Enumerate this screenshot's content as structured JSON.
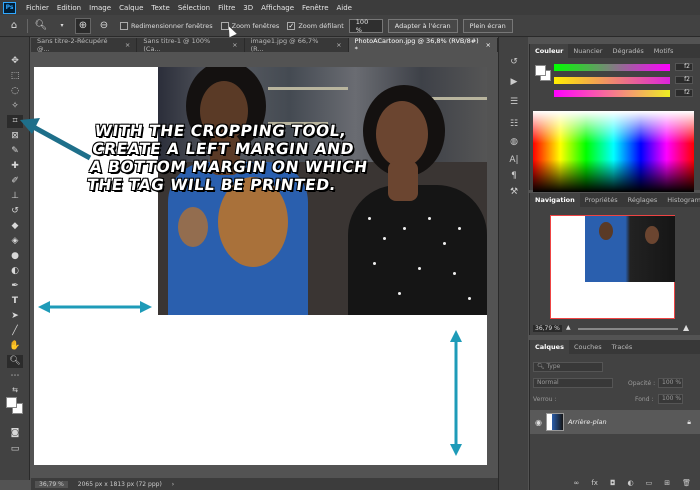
{
  "app": {
    "logo": "Ps"
  },
  "menu": [
    "Fichier",
    "Edition",
    "Image",
    "Calque",
    "Texte",
    "Sélection",
    "Filtre",
    "3D",
    "Affichage",
    "Fenêtre",
    "Aide"
  ],
  "options": {
    "resize_windows": "Redimensionner fenêtres",
    "zoom_all": "Zoom fenêtres",
    "scrubby_zoom": "Zoom défilant",
    "zoom_value": "100 %",
    "fit_screen": "Adapter à l'écran",
    "fill_screen": "Plein écran"
  },
  "tabs": [
    {
      "label": "Sans titre-2-Récupéré @...",
      "close": "×"
    },
    {
      "label": "Sans titre-1 @ 100% (Ca...",
      "close": "×"
    },
    {
      "label": "image1.jpg @ 66,7% (R...",
      "close": "×"
    },
    {
      "label": "PhotoACartoon.jpg @ 36,8% (RVB/8#) *",
      "close": "×"
    }
  ],
  "caption": "WITH THE CROPPING TOOL,\nCREATE A LEFT MARGIN AND\nA BOTTOM MARGIN ON WHICH\nTHE TAG WILL BE PRINTED.",
  "status": {
    "zoom": "36,79 %",
    "doc_size": "2065 px x 1813 px (72 ppp)"
  },
  "color_panel": {
    "tabs": [
      "Couleur",
      "Nuancier",
      "Dégradés",
      "Motifs"
    ],
    "sliders": [
      {
        "color": "#ff00ff",
        "value": "f2"
      },
      {
        "color": "#dd22dd",
        "value": "f2"
      },
      {
        "color": "#eeee22",
        "value": "f2"
      }
    ]
  },
  "nav_panel": {
    "tabs": [
      "Navigation",
      "Propriétés",
      "Réglages",
      "Histogramm"
    ],
    "zoom": "36,79 %"
  },
  "layers_panel": {
    "tabs": [
      "Calques",
      "Couches",
      "Tracés"
    ],
    "kind": "Type",
    "blend": "Normal",
    "opacity_label": "Opacité :",
    "opacity": "100 %",
    "lock_label": "Verrou :",
    "fill_label": "Fond :",
    "fill": "100 %",
    "layer_name": "Arrière-plan"
  },
  "colors": {
    "accent": "#1e9bb8",
    "panel": "#424242",
    "ps_blue": "#31a8ff"
  }
}
